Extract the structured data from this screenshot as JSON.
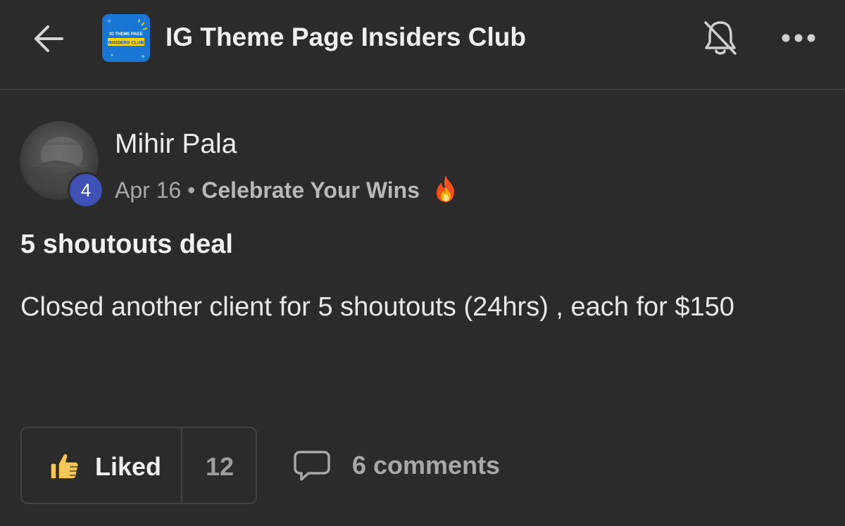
{
  "header": {
    "title": "IG Theme Page Insiders Club",
    "logo_text_top": "IG THEME PAGE",
    "logo_text_bottom": "INSIDERS CLUB",
    "icons": {
      "back": "arrow-left-icon",
      "notifications": "bell-off-icon",
      "more": "more-horizontal-icon"
    }
  },
  "post": {
    "author": "Mihir Pala",
    "author_level": "4",
    "date": "Apr 16",
    "separator": "•",
    "category": "Celebrate Your Wins",
    "category_icon": "fire-icon",
    "title": "5 shoutouts deal",
    "body": "Closed another client for 5 shoutouts (24hrs) , each for $150"
  },
  "actions": {
    "like_label": "Liked",
    "like_count": "12",
    "comments_label": "6 comments"
  },
  "colors": {
    "background": "#2b2b2b",
    "level_badge": "#3f51b5",
    "logo_blue": "#1976d2",
    "logo_yellow": "#ffd600",
    "like_icon": "#f6c75a"
  }
}
